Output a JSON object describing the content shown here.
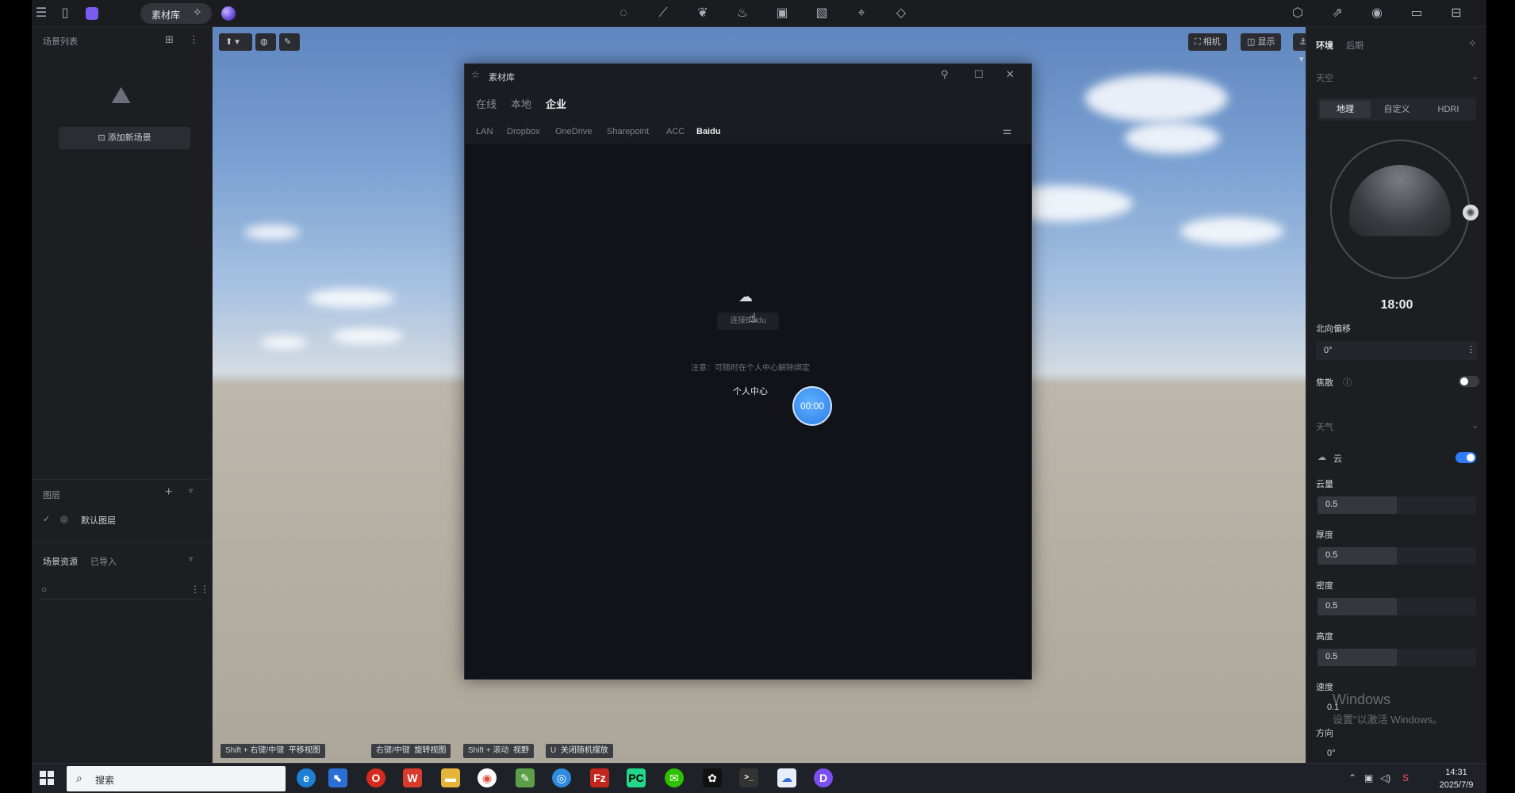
{
  "topbar": {
    "library_label": "素材库"
  },
  "left_panel": {
    "scene_list_title": "场景列表",
    "add_scene_label": "添加新场景",
    "layers_title": "图层",
    "default_layer_label": "默认图层",
    "assets_title": "场景资源",
    "imported_label": "已导入"
  },
  "viewport": {
    "tools": {
      "camera_label": "相机",
      "display_label": "显示"
    },
    "hints": [
      {
        "key": "Shift + 右键/中键",
        "action": "平移视图"
      },
      {
        "key": "右键/中键",
        "action": "旋转视图"
      },
      {
        "key": "Shift + 滚动",
        "action": "视野"
      },
      {
        "key": "U",
        "action": "关闭随机摆放"
      }
    ]
  },
  "dialog": {
    "title": "素材库",
    "source_tabs": [
      {
        "label": "在线",
        "active": false
      },
      {
        "label": "本地",
        "active": false
      },
      {
        "label": "企业",
        "active": true
      }
    ],
    "provider_tabs": [
      {
        "label": "LAN",
        "active": false
      },
      {
        "label": "Dropbox",
        "active": false
      },
      {
        "label": "OneDrive",
        "active": false
      },
      {
        "label": "Sharepoint",
        "active": false
      },
      {
        "label": "ACC",
        "active": false
      },
      {
        "label": "Baidu",
        "active": true
      }
    ],
    "connect_label": "连接Baidu",
    "note": "注意：可随时在个人中心解除绑定",
    "personal_center_label": "个人中心",
    "timer_label": "00:00"
  },
  "right_panel": {
    "tabs": [
      {
        "label": "环境",
        "active": true
      },
      {
        "label": "后期",
        "active": false
      }
    ],
    "sky_section": "天空",
    "sky_modes": [
      {
        "label": "地理",
        "selected": true
      },
      {
        "label": "自定义",
        "selected": false
      },
      {
        "label": "HDRI",
        "selected": false
      }
    ],
    "time_label": "18:00",
    "north_offset_label": "北向偏移",
    "north_offset_value": "0°",
    "focus_label": "焦散",
    "weather_section": "天气",
    "cloud_label": "云",
    "params": [
      {
        "label": "云量",
        "value": "0.5",
        "fill": 0.5
      },
      {
        "label": "厚度",
        "value": "0.5",
        "fill": 0.5
      },
      {
        "label": "密度",
        "value": "0.5",
        "fill": 0.5
      },
      {
        "label": "高度",
        "value": "0.5",
        "fill": 0.5
      }
    ],
    "speed_label": "速度",
    "speed_value": "0.1",
    "direction_label": "方向",
    "direction_value": "0°",
    "watermark_line1": "Windows",
    "watermark_line2": "设置\"以激活 Windows。"
  },
  "taskbar": {
    "search_label": "搜索",
    "time": "14:31",
    "date": "2025/7/9"
  },
  "colors": {
    "accent_blue": "#2f7cf6",
    "panel_bg": "#1d1e22",
    "dialog_bg": "#121318"
  }
}
